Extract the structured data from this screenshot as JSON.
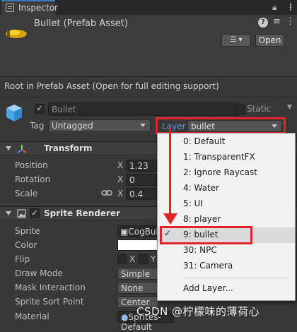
{
  "window": {
    "tab_label": "Inspector",
    "lock_icon": "lock-icon",
    "more_icon": "kebab-icon"
  },
  "header": {
    "title": "Bullet (Prefab Asset)",
    "overrides_icon": "list-icon",
    "open_label": "Open"
  },
  "root_note": "Root in Prefab Asset (Open for full editing support)",
  "gameobject": {
    "active": true,
    "name": "Bullet",
    "static_label": "Static",
    "tag_label": "Tag",
    "tag_value": "Untagged",
    "layer_label": "Layer",
    "layer_value": "bullet"
  },
  "transform": {
    "title": "Transform",
    "rows": [
      {
        "label": "Position",
        "axis": "X",
        "value": "1.23"
      },
      {
        "label": "Rotation",
        "axis": "X",
        "value": "0"
      },
      {
        "label": "Scale",
        "axis": "X",
        "value": "0.4"
      }
    ]
  },
  "sprite_renderer": {
    "title": "Sprite Renderer",
    "enabled": true,
    "sprite_label": "Sprite",
    "sprite_value": "CogBul",
    "color_label": "Color",
    "flip_label": "Flip",
    "flip_x": "X",
    "flip_y": "Y",
    "draw_mode_label": "Draw Mode",
    "draw_mode_value": "Simple",
    "mask_label": "Mask Interaction",
    "mask_value": "None",
    "sort_point_label": "Sprite Sort Point",
    "sort_point_value": "Center",
    "material_label": "Material",
    "material_value": "Sprites-Default"
  },
  "layer_menu": {
    "items": [
      "0: Default",
      "1: TransparentFX",
      "2: Ignore Raycast",
      "4: Water",
      "5: UI",
      "8: player",
      "9: bullet",
      "30: NPC",
      "31: Camera"
    ],
    "selected": "9: bullet",
    "add_label": "Add Layer..."
  },
  "annotation_color": "#e0242a",
  "watermark": "CSDN @柠檬味的薄荷心"
}
